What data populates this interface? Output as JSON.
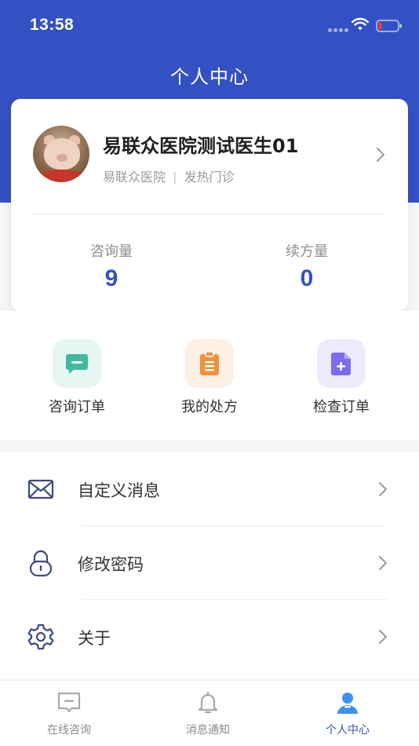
{
  "status_bar": {
    "time": "13:58"
  },
  "header": {
    "title": "个人中心"
  },
  "profile": {
    "name": "易联众医院测试医生01",
    "hospital": "易联众医院",
    "separator": "|",
    "department": "发热门诊",
    "stats": [
      {
        "label": "咨询量",
        "value": "9"
      },
      {
        "label": "续方量",
        "value": "0"
      }
    ]
  },
  "quick_actions": [
    {
      "label": "咨询订单",
      "icon": "chat-icon",
      "color": "#3fba9f"
    },
    {
      "label": "我的处方",
      "icon": "clipboard-icon",
      "color": "#f0913a"
    },
    {
      "label": "检查订单",
      "icon": "document-plus-icon",
      "color": "#7b6cf0"
    }
  ],
  "menu": [
    {
      "label": "自定义消息",
      "icon": "mail-icon"
    },
    {
      "label": "修改密码",
      "icon": "lock-icon"
    },
    {
      "label": "关于",
      "icon": "gear-icon"
    }
  ],
  "tabbar": [
    {
      "label": "在线咨询",
      "icon": "chat-box-icon",
      "active": false
    },
    {
      "label": "消息通知",
      "icon": "bell-icon",
      "active": false
    },
    {
      "label": "个人中心",
      "icon": "person-icon",
      "active": true
    }
  ],
  "colors": {
    "brand": "#3451c3",
    "tab_inactive": "#8a8a8a",
    "background": "#f5f6f8"
  }
}
